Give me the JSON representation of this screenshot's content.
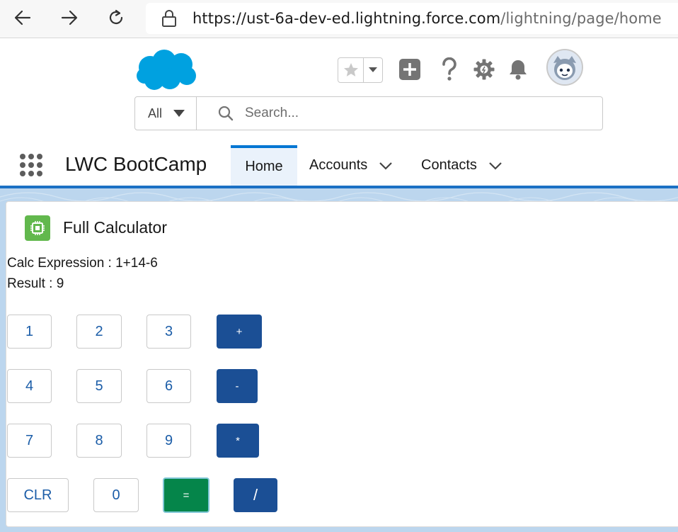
{
  "browser": {
    "url_main": "https://ust-6a-dev-ed.lightning.force.com",
    "url_path": "/lightning/page/home"
  },
  "header": {
    "search_scope": "All",
    "search_placeholder": "Search..."
  },
  "nav": {
    "app_name": "LWC BootCamp",
    "items": [
      {
        "label": "Home",
        "active": true
      },
      {
        "label": "Accounts",
        "active": false
      },
      {
        "label": "Contacts",
        "active": false
      }
    ]
  },
  "calculator": {
    "title": "Full Calculator",
    "expression_text": "Calc Expression : 1+14-6",
    "result_text": "Result : 9",
    "buttons": {
      "b1": "1",
      "b2": "2",
      "b3": "3",
      "plus": "+",
      "b4": "4",
      "b5": "5",
      "b6": "6",
      "minus": "-",
      "b7": "7",
      "b8": "8",
      "b9": "9",
      "mult": "*",
      "clr": "CLR",
      "b0": "0",
      "equals": "=",
      "div": "/"
    }
  },
  "colors": {
    "salesforce_blue": "#00a1e0",
    "active_tab_border": "#0176d3",
    "brand_button": "#1b4f95",
    "success_button": "#05854a",
    "card_icon": "#62b84d"
  }
}
